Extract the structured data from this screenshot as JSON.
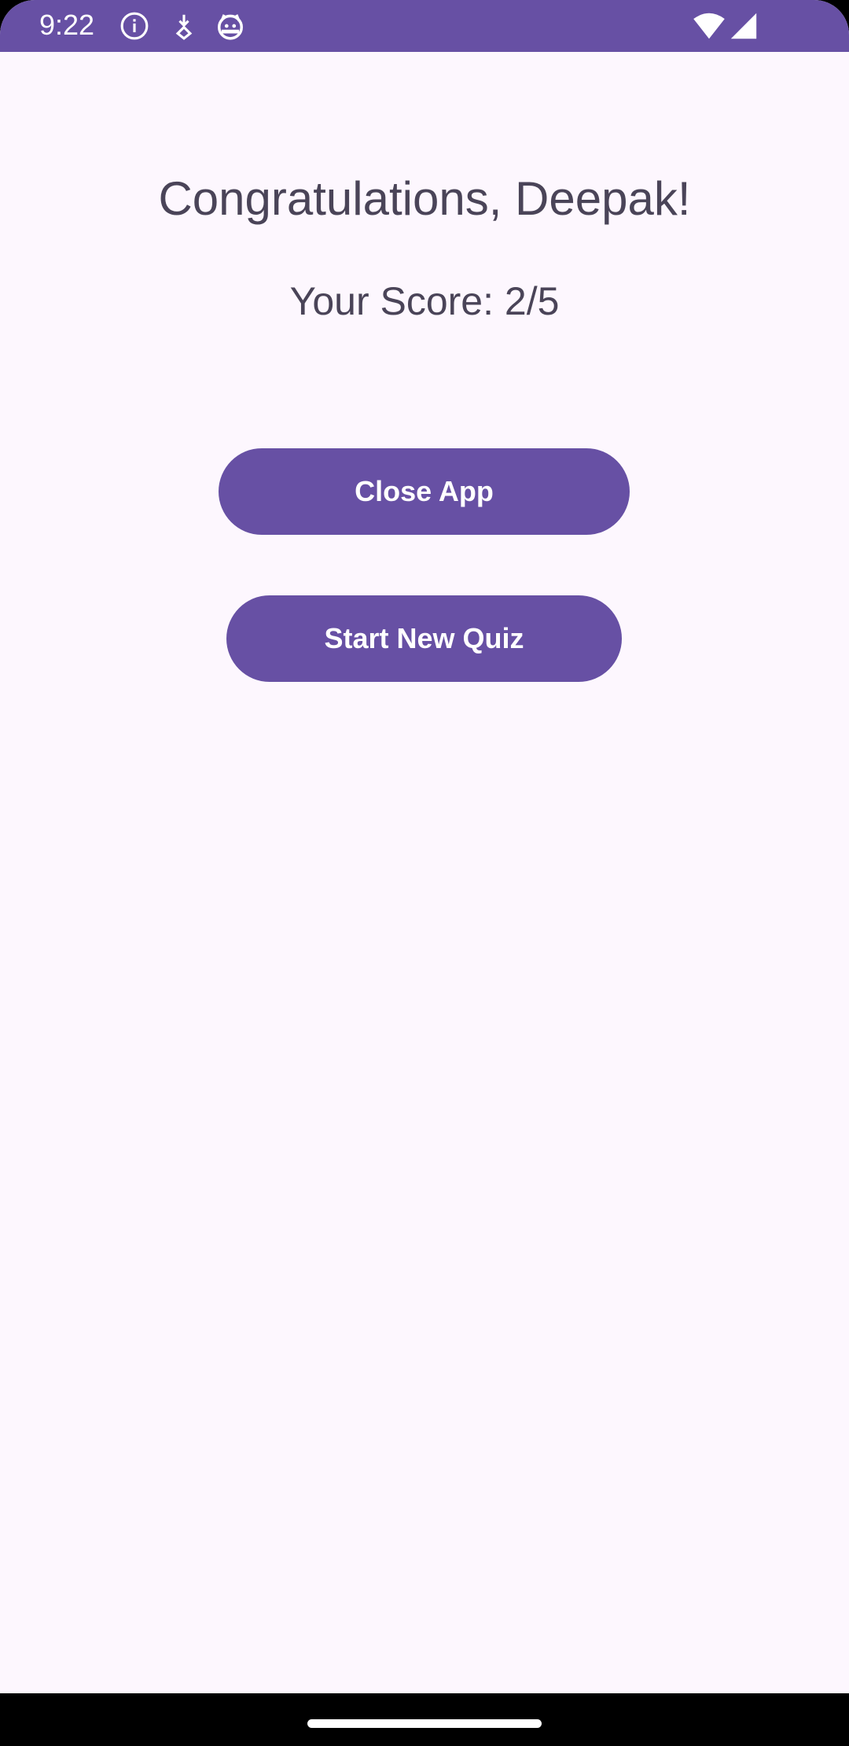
{
  "status_bar": {
    "time": "9:22",
    "icons": [
      "info-icon",
      "download-icon",
      "android-icon",
      "wifi-icon",
      "signal-icon"
    ],
    "background_color": "#6750a4"
  },
  "main": {
    "greeting": "Congratulations, Deepak!",
    "score_text": "Your Score: 2/5",
    "close_button_label": "Close App",
    "new_quiz_button_label": "Start New Quiz"
  },
  "colors": {
    "accent": "#6750a4",
    "background": "#fdf7fe",
    "text": "#4a4458"
  }
}
